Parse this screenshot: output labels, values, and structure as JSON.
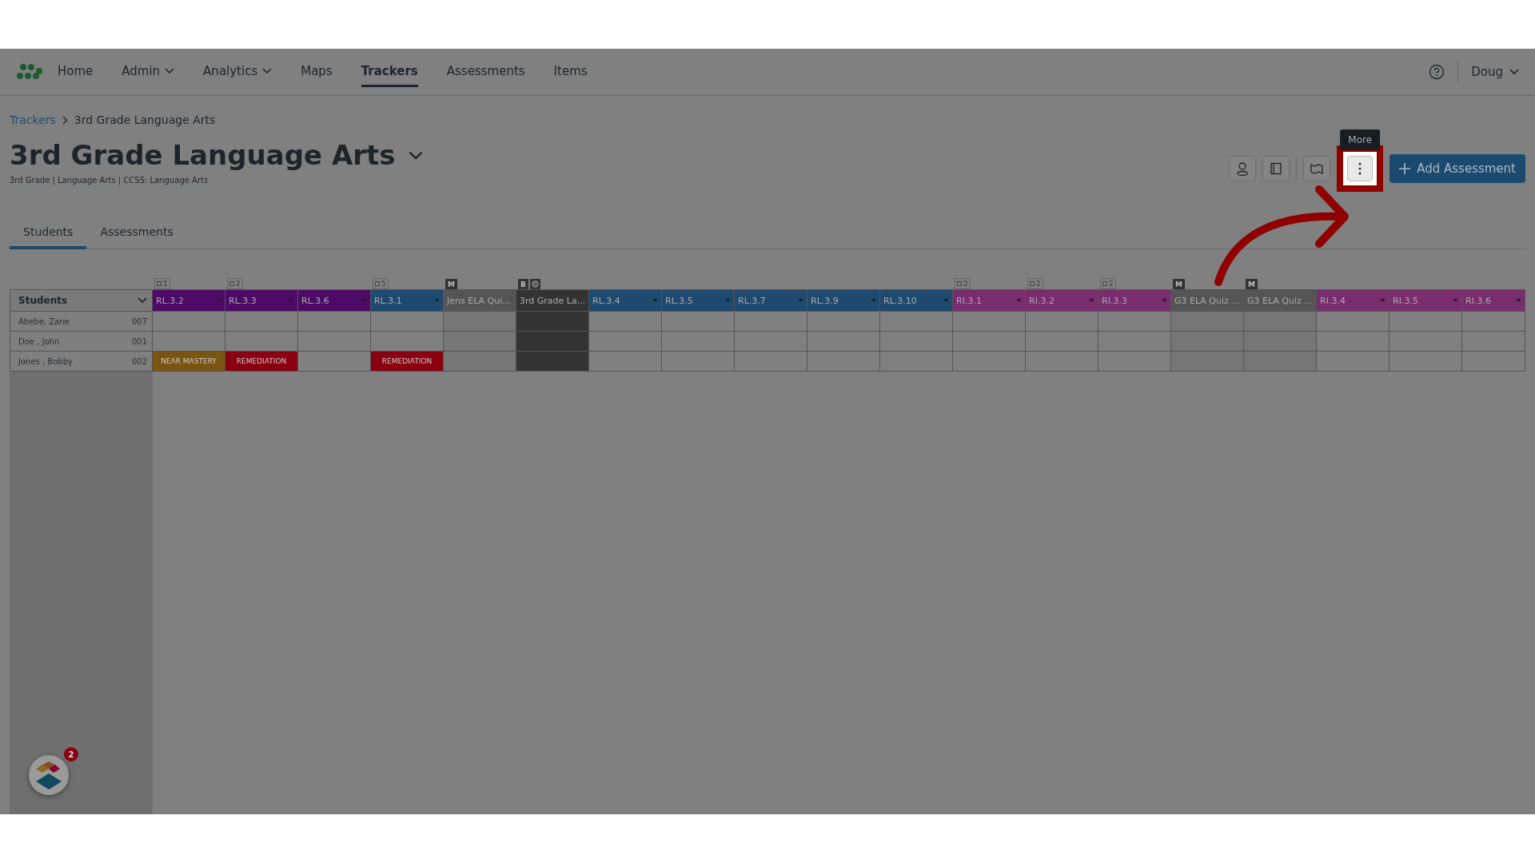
{
  "nav": {
    "items": [
      {
        "label": "Home",
        "dropdown": false,
        "selected": false
      },
      {
        "label": "Admin",
        "dropdown": true,
        "selected": false
      },
      {
        "label": "Analytics",
        "dropdown": true,
        "selected": false
      },
      {
        "label": "Maps",
        "dropdown": false,
        "selected": false
      },
      {
        "label": "Trackers",
        "dropdown": false,
        "selected": true
      },
      {
        "label": "Assessments",
        "dropdown": false,
        "selected": false
      },
      {
        "label": "Items",
        "dropdown": false,
        "selected": false
      }
    ],
    "user": "Doug"
  },
  "breadcrumb": [
    "Trackers",
    "3rd Grade Language Arts"
  ],
  "title": "3rd Grade Language Arts",
  "meta": "3rd Grade  |  Language Arts  |  CCSS: Language Arts",
  "toolbar": {
    "tooltip": "More",
    "add_button": "Add Assessment"
  },
  "tabs": [
    {
      "label": "Students",
      "selected": true
    },
    {
      "label": "Assessments",
      "selected": false
    }
  ],
  "table": {
    "first_column": "Students",
    "columns": [
      {
        "label": "RL.3.2",
        "color": "#4d0a66",
        "kind": "standard",
        "badge": {
          "kind": "count",
          "text": "1"
        }
      },
      {
        "label": "RL.3.3",
        "color": "#4d0a66",
        "kind": "standard",
        "badge": {
          "kind": "count",
          "text": "2"
        }
      },
      {
        "label": "RL.3.6",
        "color": "#4d0a66",
        "kind": "standard"
      },
      {
        "label": "RL.3.1",
        "color": "#1f4a70",
        "kind": "standard",
        "badge": {
          "kind": "count",
          "text": "5"
        }
      },
      {
        "label": "Jens ELA Qui...",
        "color": "#555555",
        "kind": "quiz",
        "badge": {
          "kind": "letter",
          "text": "M"
        }
      },
      {
        "label": "3rd Grade La...",
        "color": "#333333",
        "kind": "benchmark",
        "badge": {
          "kind": "letter_check",
          "text": "B"
        }
      },
      {
        "label": "RL.3.4",
        "color": "#1f4a70",
        "kind": "standard"
      },
      {
        "label": "RL.3.5",
        "color": "#1f4a70",
        "kind": "standard"
      },
      {
        "label": "RL.3.7",
        "color": "#1f4a70",
        "kind": "standard"
      },
      {
        "label": "RL.3.9",
        "color": "#1f4a70",
        "kind": "standard"
      },
      {
        "label": "RL.3.10",
        "color": "#1f4a70",
        "kind": "standard"
      },
      {
        "label": "RI.3.1",
        "color": "#7a2d6e",
        "kind": "standard",
        "badge": {
          "kind": "count",
          "text": "2"
        }
      },
      {
        "label": "RI.3.2",
        "color": "#7a2d6e",
        "kind": "standard",
        "badge": {
          "kind": "count",
          "text": "2"
        }
      },
      {
        "label": "RI.3.3",
        "color": "#7a2d6e",
        "kind": "standard",
        "badge": {
          "kind": "count",
          "text": "2"
        }
      },
      {
        "label": "G3 ELA Quiz ...",
        "color": "#555555",
        "kind": "quiz",
        "badge": {
          "kind": "letter",
          "text": "M"
        }
      },
      {
        "label": "G3 ELA Quiz ...",
        "color": "#555555",
        "kind": "quiz",
        "badge": {
          "kind": "letter",
          "text": "M"
        }
      },
      {
        "label": "RI.3.4",
        "color": "#7a2d6e",
        "kind": "standard"
      },
      {
        "label": "RI.3.5",
        "color": "#7a2d6e",
        "kind": "standard"
      },
      {
        "label": "RI.3.6",
        "color": "#7a2d6e",
        "kind": "standard"
      }
    ],
    "rows": [
      {
        "name": "Abebe, Zane",
        "id": "007",
        "cells": []
      },
      {
        "name": "Doe , John",
        "id": "001",
        "cells": []
      },
      {
        "name": "Jones , Bobby",
        "id": "002",
        "cells": [
          {
            "text": "NEAR MASTERY",
            "color": "#7a5410"
          },
          {
            "text": "REMEDIATION",
            "color": "#8b0010"
          },
          null,
          {
            "text": "REMEDIATION",
            "color": "#8b0010"
          }
        ]
      }
    ]
  },
  "widget_badge": "2"
}
